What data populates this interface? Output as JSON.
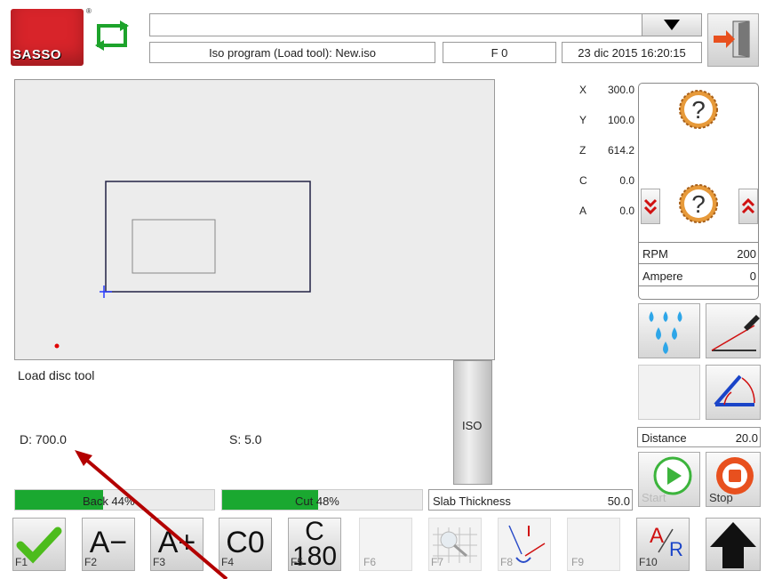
{
  "header": {
    "logo_text": "SASSO",
    "registered": "®",
    "combo_value": "",
    "program": "Iso program (Load tool): New.iso",
    "feed": "F 0",
    "datetime": "23 dic 2015 16:20:15"
  },
  "coords": [
    {
      "axis": "X",
      "value": "300.0"
    },
    {
      "axis": "Y",
      "value": "100.0"
    },
    {
      "axis": "Z",
      "value": "614.2"
    },
    {
      "axis": "C",
      "value": "0.0"
    },
    {
      "axis": "A",
      "value": "0.0"
    }
  ],
  "spindle": {
    "rpm_label": "RPM",
    "rpm_value": "200",
    "ampere_label": "Ampere",
    "ampere_value": "0"
  },
  "info": {
    "message": "Load disc tool",
    "d_label": "D:",
    "d_value": "700.0",
    "s_label": "S:",
    "s_value": "5.0",
    "iso_label": "ISO"
  },
  "distance": {
    "label": "Distance",
    "value": "20.0"
  },
  "run": {
    "start_label": "Start",
    "stop_label": "Stop"
  },
  "progress": {
    "back": {
      "label": "Back 44%",
      "fraction": 0.44
    },
    "cut": {
      "label": "Cut 48%",
      "fraction": 0.48
    }
  },
  "slab": {
    "label": "Slab Thickness",
    "value": "50.0"
  },
  "fkeys": {
    "f1": "F1",
    "f2": "F2",
    "f2_text": "A−",
    "f3": "F3",
    "f3_text": "A+",
    "f4": "F4",
    "f4_text": "C0",
    "f5": "F5",
    "f5_top": "C",
    "f5_bottom": "180",
    "f6": "F6",
    "f7": "F7",
    "f8": "F8",
    "f9": "F9",
    "f10": "F10",
    "f10_a": "A",
    "f10_r": "R"
  },
  "colors": {
    "accent_red": "#d8242a",
    "progress_green": "#1aa830",
    "arrow_red": "#b30000"
  }
}
